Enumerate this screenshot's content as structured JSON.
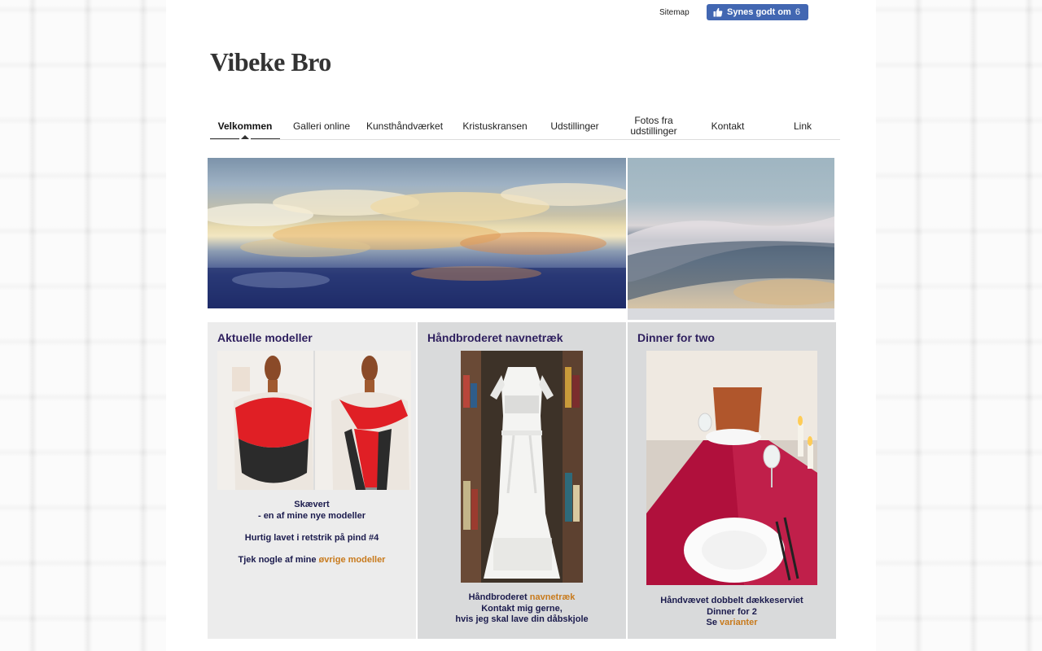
{
  "header": {
    "sitemap_label": "Sitemap",
    "fb_like_label": "Synes godt om",
    "fb_like_count": "6",
    "site_title": "Vibeke Bro"
  },
  "nav": {
    "items": [
      {
        "label": "Velkommen",
        "active": true
      },
      {
        "label": "Galleri online",
        "active": false
      },
      {
        "label": "Kunsthåndværket",
        "active": false
      },
      {
        "label": "Kristuskransen",
        "active": false
      },
      {
        "label": "Udstillinger",
        "active": false
      },
      {
        "label": "Fotos fra udstillinger",
        "active": false
      },
      {
        "label": "Kontakt",
        "active": false
      },
      {
        "label": "Link",
        "active": false
      }
    ]
  },
  "columns": [
    {
      "heading": "Aktuelle modeller",
      "lines": [
        "Skævert",
        "- en af mine nye modeller",
        "Hurtig lavet i retstrik på pind #4"
      ],
      "link_prefix": "Tjek nogle af mine",
      "link_label": "øvrige modeller"
    },
    {
      "heading": "Håndbroderet navnetræk",
      "line1_prefix": "Håndbroderet",
      "line1_link": "navnetræk",
      "lines": [
        "Kontakt mig gerne,",
        "hvis jeg skal lave din dåbskjole"
      ]
    },
    {
      "heading": "Dinner for two",
      "lines": [
        "Håndvævet dobbelt dækkeserviet",
        "Dinner for 2"
      ],
      "link_prefix": "Se",
      "link_label": "varianter"
    }
  ],
  "colors": {
    "heading": "#2e1f5e",
    "body_text": "#1b1b4d",
    "link": "#c87a1c",
    "fb_blue": "#4267b2"
  }
}
